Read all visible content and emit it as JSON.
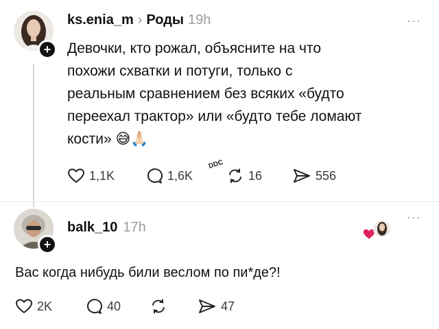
{
  "post": {
    "username": "ks.enia_m",
    "separator": "›",
    "community": "Роды",
    "time": "19h",
    "more": "···",
    "text_lines": [
      "Девочки, кто рожал, объясните на что",
      "похожи схватки и потуги, только с",
      "реальным сравнением без всяких «будто",
      "переехал трактор» или «будто тебе ломают",
      "кости»"
    ],
    "emoji": "😅🙏🏻",
    "actions": {
      "likes": "1,1K",
      "comments": "1,6K",
      "reposts": "16",
      "shares": "556"
    },
    "watermark": "DDC"
  },
  "reply": {
    "username": "balk_10",
    "time": "17h",
    "more": "···",
    "text": "Вас когда нибудь били веслом по пи*де?!",
    "actions": {
      "likes": "2K",
      "comments": "40",
      "reposts": "",
      "shares": "47"
    }
  },
  "icons": [
    "heart-icon",
    "comment-icon",
    "repost-icon",
    "share-icon",
    "follow-plus-icon"
  ],
  "colors": {
    "text": "#111111",
    "muted": "#9a9a9a",
    "line": "#d6d6d6",
    "like_heart": "#e0245e"
  }
}
